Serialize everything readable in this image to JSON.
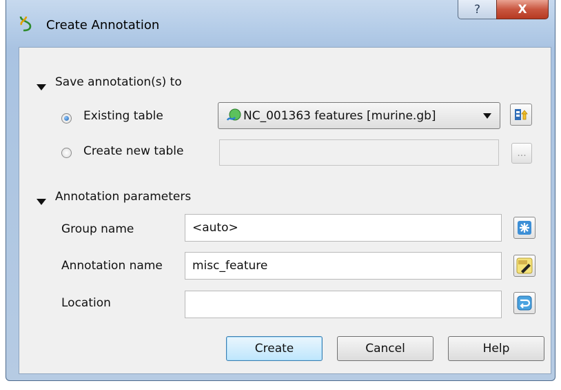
{
  "window": {
    "title": "Create Annotation",
    "help_glyph": "?",
    "close_glyph": "X"
  },
  "save_section": {
    "title": "Save annotation(s) to",
    "existing_table_label": "Existing table",
    "existing_table_selected": true,
    "existing_table_value": "NC_001363 features [murine.gb]",
    "create_new_table_label": "Create new table",
    "create_new_table_value": "",
    "browse_label": "..."
  },
  "params_section": {
    "title": "Annotation parameters",
    "group_name_label": "Group name",
    "group_name_value": "<auto>",
    "annotation_name_label": "Annotation name",
    "annotation_name_value": "misc_feature",
    "location_label": "Location",
    "location_value": ""
  },
  "buttons": {
    "create": "Create",
    "cancel": "Cancel",
    "help": "Help"
  },
  "icons": {
    "title": "dna-helix-icon",
    "object_select": "object-select-icon",
    "group_name": "snowflake-icon",
    "annotation_name": "text-edit-icon",
    "location": "undo-arrow-icon"
  }
}
